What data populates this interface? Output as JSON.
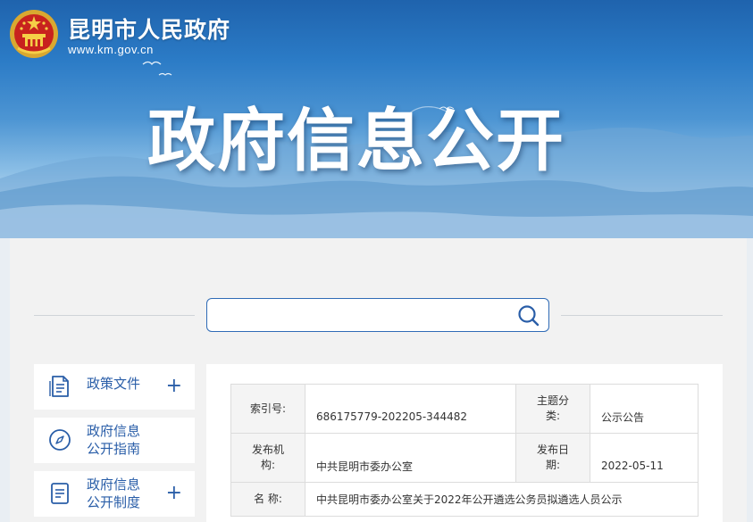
{
  "header": {
    "site_name": "昆明市人民政府",
    "site_url": "www.km.gov.cn",
    "banner_title": "政府信息公开"
  },
  "search": {
    "value": "",
    "placeholder": ""
  },
  "sidebar": {
    "items": [
      {
        "label_line1": "政策文件",
        "label_line2": "",
        "icon": "document-icon",
        "expand": "+"
      },
      {
        "label_line1": "政府信息",
        "label_line2": "公开指南",
        "icon": "compass-icon",
        "expand": ""
      },
      {
        "label_line1": "政府信息",
        "label_line2": "公开制度",
        "icon": "clipboard-icon",
        "expand": "+"
      }
    ]
  },
  "meta_table": {
    "index_no_label": "索引号:",
    "index_no": "686175779-202205-344482",
    "category_label_1": "主题分",
    "category_label_2": "类:",
    "category": "公示公告",
    "issuer_label_1": "发布机",
    "issuer_label_2": "构:",
    "issuer": "中共昆明市委办公室",
    "date_label_1": "发布日",
    "date_label_2": "期:",
    "date": "2022-05-11",
    "name_label": "名 称:",
    "name": "中共昆明市委办公室关于2022年公开遴选公务员拟遴选人员公示"
  },
  "colors": {
    "primary_blue": "#2a5ea8",
    "banner_top": "#1f63ad",
    "panel_bg": "#f2f2f2"
  }
}
